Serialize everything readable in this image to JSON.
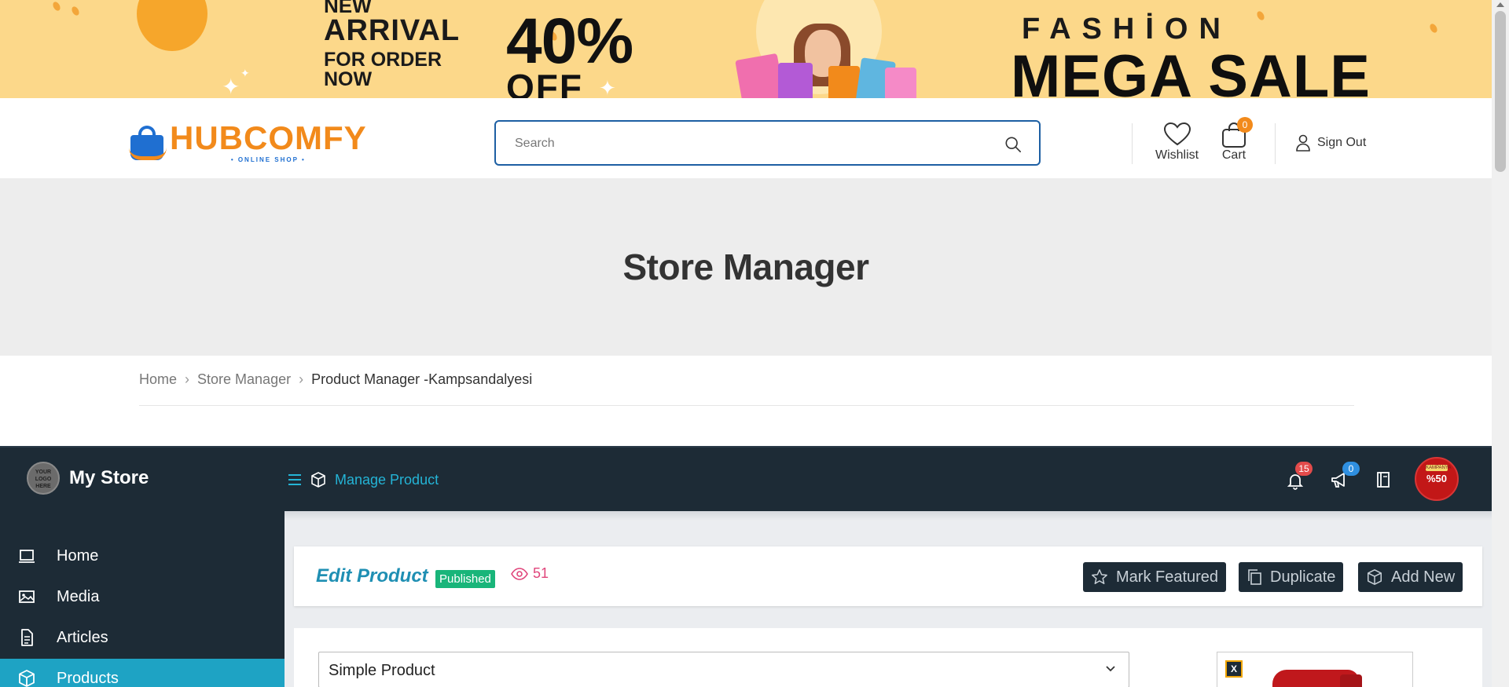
{
  "banner": {
    "line1": "NEW",
    "line2": "ARRIVAL",
    "line3": "FOR ORDER",
    "line4": "NOW",
    "discount": "40%",
    "off": "OFF",
    "fashion": "FASHİON",
    "mega_sale": "MEGA SALE"
  },
  "header": {
    "logo_name": "HUBCOMFY",
    "logo_tagline": "• ONLINE SHOP •",
    "search_placeholder": "Search",
    "wishlist_label": "Wishlist",
    "cart_label": "Cart",
    "cart_count": "0",
    "signout_label": "Sign Out",
    "brand_colors": {
      "orange": "#f28a1b",
      "blue": "#1f6fd1"
    }
  },
  "page": {
    "title": "Store Manager"
  },
  "breadcrumb": {
    "items": [
      "Home",
      "Store Manager",
      "Product Manager -Kampsandalyesi"
    ]
  },
  "dashboard": {
    "logo_text": "YOUR LOGO HERE",
    "store_name": "My Store",
    "section_title": "Manage Product",
    "notifications_count": "15",
    "announcements_count": "0",
    "promo_top": "KAMPANYA",
    "promo_value": "%50",
    "sidebar": [
      {
        "label": "Home",
        "icon": "monitor-icon"
      },
      {
        "label": "Media",
        "icon": "image-icon"
      },
      {
        "label": "Articles",
        "icon": "document-icon"
      },
      {
        "label": "Products",
        "icon": "cube-icon",
        "active": true
      }
    ],
    "edit": {
      "title": "Edit Product",
      "status": "Published",
      "views": "51",
      "buttons": [
        "Mark Featured",
        "Duplicate",
        "Add New"
      ]
    },
    "form": {
      "product_type": "Simple Product",
      "image_remove": "X"
    },
    "colors": {
      "accent": "#1ea3c4",
      "dark": "#1d2b36",
      "published": "#19b57a",
      "views": "#e0457b"
    }
  }
}
